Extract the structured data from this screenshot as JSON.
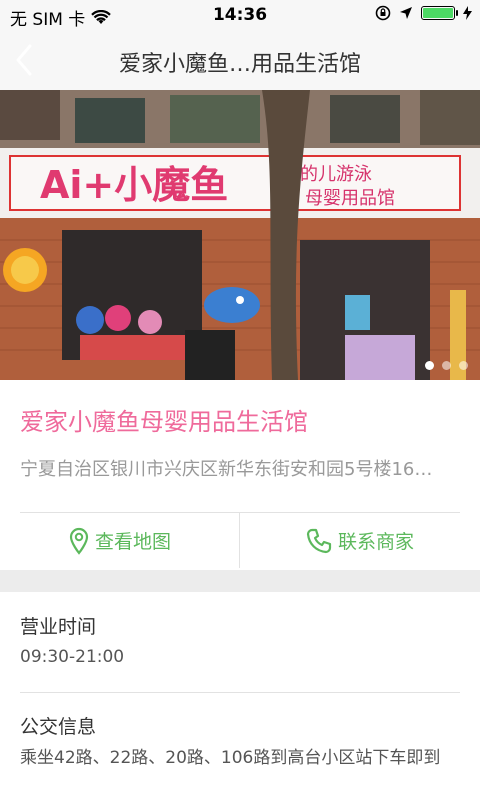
{
  "status_bar": {
    "carrier": "无 SIM 卡",
    "time": "14:36",
    "battery_level": 1.0,
    "icons": [
      "wifi-icon",
      "rotation-lock-icon",
      "location-arrow-icon",
      "battery-icon",
      "charging-bolt-icon"
    ]
  },
  "nav": {
    "title": "爱家小魔鱼…用品生活馆",
    "back_icon": "chevron-left-icon"
  },
  "banner": {
    "sign_text": "Ai+小魔鱼",
    "slides": 3,
    "active_slide": 1
  },
  "store": {
    "name": "爱家小魔鱼母婴用品生活馆",
    "address": "宁夏自治区银川市兴庆区新华东街安和园5号楼16…"
  },
  "actions": {
    "map_label": "查看地图",
    "contact_label": "联系商家"
  },
  "hours": {
    "title": "营业时间",
    "value": "09:30-21:00"
  },
  "transit": {
    "title": "公交信息",
    "value": "乘坐42路、22路、20路、106路到高台小区站下车即到"
  },
  "colors": {
    "accent_pink": "#ef6a9b",
    "action_green": "#5cb85c",
    "nav_background": "#f7f7f7"
  }
}
